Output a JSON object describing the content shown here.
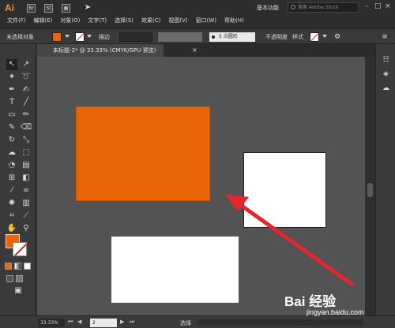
{
  "app": {
    "logo": "Ai"
  },
  "titlebar": {
    "workspace": "基本功能",
    "search_placeholder": "搜索 Adobe Stock",
    "window_controls": [
      "–",
      "□",
      "×"
    ],
    "icons": [
      "bridge-icon",
      "stock-icon",
      "layout-icon",
      "send-icon"
    ]
  },
  "menu": {
    "items": [
      "文件(F)",
      "编辑(E)",
      "对象(O)",
      "文字(T)",
      "选择(S)",
      "效果(C)",
      "视图(V)",
      "窗口(W)",
      "帮助(H)"
    ]
  },
  "control_bar": {
    "selection_label": "未选择对象",
    "stroke_label": "描边",
    "point_label": "5 点圆形",
    "opacity_label": "不透明度",
    "style_label": "样式",
    "fill_color": "#e96505",
    "stroke_color": "#ffffff"
  },
  "document_tab": {
    "title": "未标题-2* @ 33.33% (CMYK/GPU 预览)",
    "close": "×"
  },
  "canvas": {
    "background": "#535353",
    "shapes": [
      {
        "name": "orange-rectangle",
        "fill": "#e96505"
      },
      {
        "name": "white-rectangle-right",
        "fill": "#ffffff"
      },
      {
        "name": "white-rectangle-bottom",
        "fill": "#ffffff"
      }
    ],
    "annotation_arrow_color": "#e5262e"
  },
  "status_bar": {
    "zoom": "33.33%",
    "page": "2",
    "mode": "选择"
  },
  "watermark": {
    "main": "Bai 经验",
    "sub": "jingyan.baidu.com"
  }
}
